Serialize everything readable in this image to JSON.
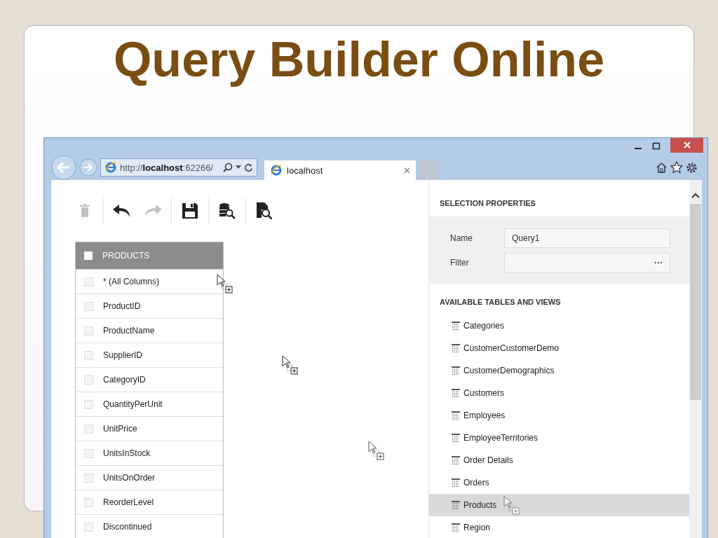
{
  "slide_title": "Query Builder Online",
  "browser": {
    "address": "http://**localhost**:62266/",
    "tab": {
      "title": "localhost",
      "selected": true
    }
  },
  "toolbar": [
    {
      "kind": "delete",
      "disabled": true
    },
    {
      "kind": "undo",
      "disabled": false
    },
    {
      "kind": "redo",
      "disabled": true
    },
    {
      "kind": "save",
      "disabled": false
    },
    {
      "kind": "data-source",
      "disabled": false
    },
    {
      "kind": "preview",
      "disabled": false
    }
  ],
  "table": {
    "title": "PRODUCTS",
    "checked": false,
    "columns": [
      {
        "name": "* (All Columns)",
        "checked": false
      },
      {
        "name": "ProductID",
        "checked": false
      },
      {
        "name": "ProductName",
        "checked": false
      },
      {
        "name": "SupplierID",
        "checked": false
      },
      {
        "name": "CategoryID",
        "checked": false
      },
      {
        "name": "QuantityPerUnit",
        "checked": false
      },
      {
        "name": "UnitPrice",
        "checked": false
      },
      {
        "name": "UnitsInStock",
        "checked": false
      },
      {
        "name": "UnitsOnOrder",
        "checked": false
      },
      {
        "name": "ReorderLevel",
        "checked": false
      },
      {
        "name": "Discontinued",
        "checked": false
      }
    ]
  },
  "selection_properties": {
    "title": "SELECTION PROPERTIES",
    "fields": [
      {
        "label": "Name",
        "value": "Query1"
      },
      {
        "label": "Filter",
        "button": "···"
      }
    ]
  },
  "available": {
    "title": "AVAILABLE TABLES AND VIEWS",
    "items": [
      {
        "name": "Categories",
        "selected": false
      },
      {
        "name": "CustomerCustomerDemo",
        "selected": false
      },
      {
        "name": "CustomerDemographics",
        "selected": false
      },
      {
        "name": "Customers",
        "selected": false
      },
      {
        "name": "Employees",
        "selected": false
      },
      {
        "name": "EmployeeTerritories",
        "selected": false
      },
      {
        "name": "Order Details",
        "selected": false
      },
      {
        "name": "Orders",
        "selected": false
      },
      {
        "name": "Products",
        "selected": true
      },
      {
        "name": "Region",
        "selected": false
      }
    ]
  }
}
